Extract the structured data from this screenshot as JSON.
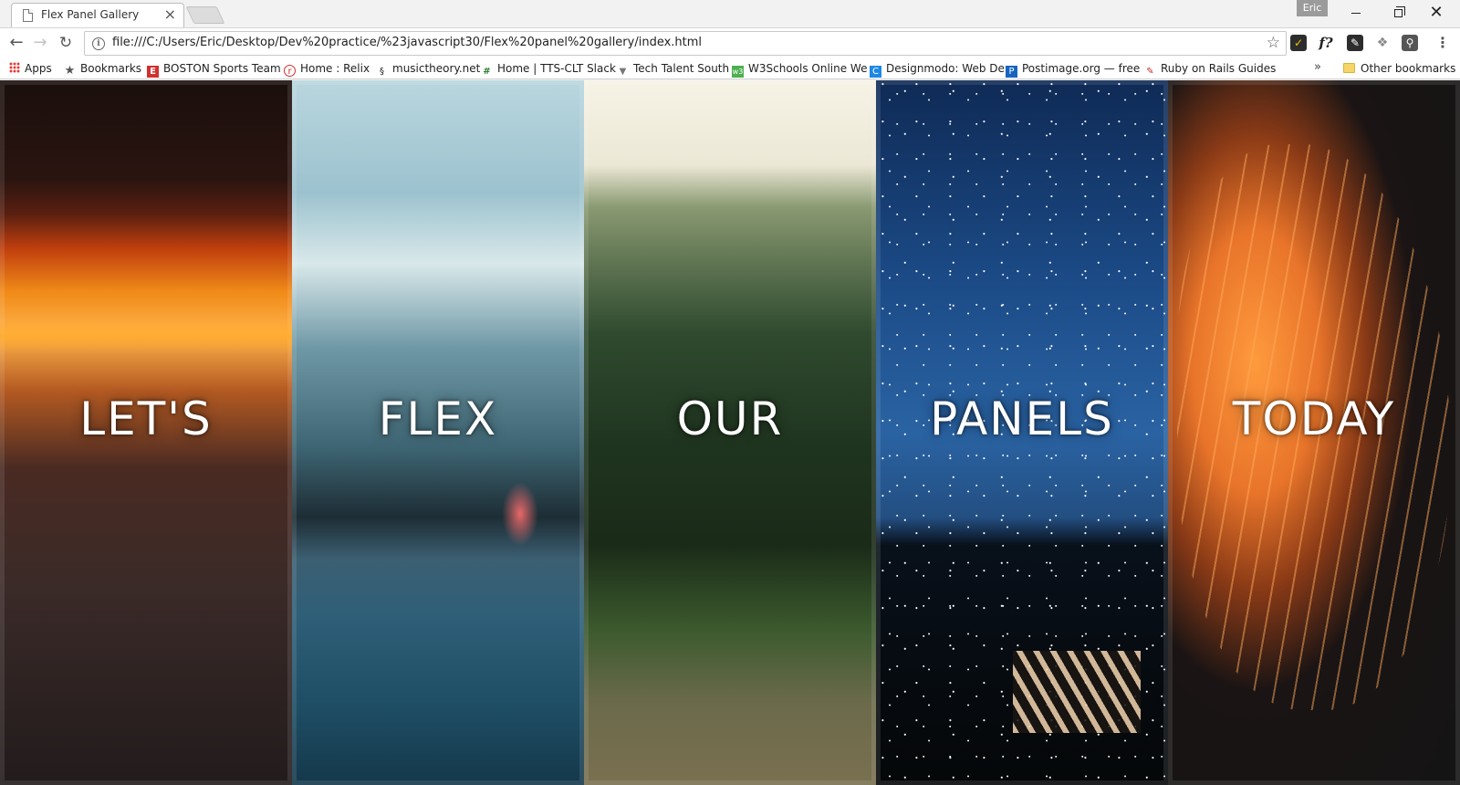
{
  "browser": {
    "tab": {
      "title": "Flex Panel Gallery",
      "close": "×"
    },
    "profile": "Eric",
    "window_controls": {
      "close": "✕"
    },
    "nav": {
      "back": "←",
      "forward": "→",
      "reload": "↻"
    },
    "address_bar": {
      "info": "i",
      "url": "file:///C:/Users/Eric/Desktop/Dev%20practice/%23javascript30/Flex%20panel%20gallery/index.html",
      "star": "☆"
    },
    "extensions": [
      {
        "name": "norton-icon",
        "glyph": "✓"
      },
      {
        "name": "font-finder-icon",
        "glyph": "f?"
      },
      {
        "name": "evernote-icon",
        "glyph": "✎"
      },
      {
        "name": "dropbox-icon",
        "glyph": "❖"
      },
      {
        "name": "keeper-icon",
        "glyph": "⚲"
      }
    ],
    "menu": "⋮"
  },
  "bookmarks": {
    "items": [
      {
        "label": "Apps",
        "icon": "apps-grid-icon"
      },
      {
        "label": "Bookmarks",
        "icon": "star-icon",
        "glyph": "★",
        "color": "#555555"
      },
      {
        "label": "BOSTON Sports Team",
        "icon": "espn-icon",
        "glyph": "E",
        "color": "#d32f2f"
      },
      {
        "label": "Home : Relix",
        "icon": "relix-icon",
        "glyph": "r",
        "color": "#d32f2f"
      },
      {
        "label": "musictheory.net",
        "icon": "musictheory-icon",
        "glyph": "§",
        "color": "#222222"
      },
      {
        "label": "Home | TTS-CLT Slack",
        "icon": "slack-icon",
        "glyph": "#",
        "color": "#2e7d32"
      },
      {
        "label": "Tech Talent South",
        "icon": "tts-icon",
        "glyph": "▼",
        "color": "#777777"
      },
      {
        "label": "W3Schools Online We",
        "icon": "w3schools-icon",
        "glyph": "w3",
        "color": "#4caf50"
      },
      {
        "label": "Designmodo: Web De",
        "icon": "designmodo-icon",
        "glyph": "C",
        "color": "#1e88e5"
      },
      {
        "label": "Postimage.org — free",
        "icon": "postimage-icon",
        "glyph": "P",
        "color": "#1565c0"
      },
      {
        "label": "Ruby on Rails Guides",
        "icon": "rails-icon",
        "glyph": "✎",
        "color": "#c62828"
      }
    ],
    "more": "»",
    "other": "Other bookmarks"
  },
  "panels": [
    {
      "word": "LET'S"
    },
    {
      "word": "FLEX"
    },
    {
      "word": "OUR"
    },
    {
      "word": "PANELS"
    },
    {
      "word": "TODAY"
    }
  ]
}
